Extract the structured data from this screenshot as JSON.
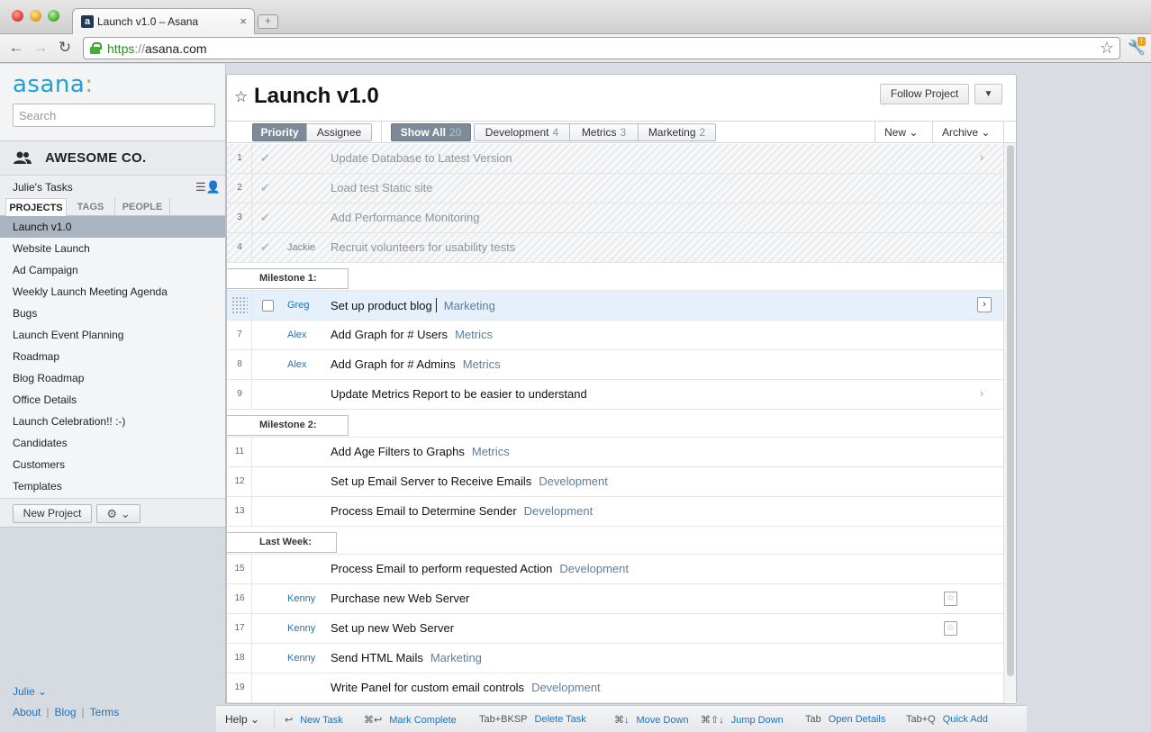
{
  "browser": {
    "tab_title": "Launch v1.0 – Asana",
    "tab_favicon": "a",
    "url_scheme": "https",
    "url_sep": "://",
    "url_host": "asana.com",
    "new_tab_glyph": "+",
    "close_glyph": "×"
  },
  "sidebar": {
    "logo": "asana",
    "logo_dots": ":",
    "search_placeholder": "Search",
    "workspace": "AWESOME CO.",
    "my_tasks": "Julie's Tasks",
    "tabs": [
      "PROJECTS",
      "TAGS",
      "PEOPLE"
    ],
    "projects": [
      "Launch v1.0",
      "Website Launch",
      "Ad Campaign",
      "Weekly Launch Meeting Agenda",
      "Bugs",
      "Launch Event Planning",
      "Roadmap",
      "Blog Roadmap",
      "Office Details",
      "Launch Celebration!! :-)",
      "Candidates",
      "Customers",
      "Templates"
    ],
    "active_project_index": 0,
    "new_project_label": "New Project",
    "user": "Julie",
    "footer_links": [
      "About",
      "Blog",
      "Terms"
    ]
  },
  "main": {
    "title": "Launch  v1.0",
    "follow_label": "Follow Project",
    "filters": {
      "priority": "Priority",
      "assignee": "Assignee",
      "show_all": "Show All",
      "show_all_count": "20",
      "development": "Development",
      "development_count": "4",
      "metrics": "Metrics",
      "metrics_count": "3",
      "marketing": "Marketing",
      "marketing_count": "2",
      "new": "New",
      "archive": "Archive"
    },
    "rows": [
      {
        "type": "task",
        "num": "1",
        "done": true,
        "assignee": "",
        "name": "Update Database to Latest Version",
        "tag": "",
        "arrow": true
      },
      {
        "type": "task",
        "num": "2",
        "done": true,
        "assignee": "",
        "name": "Load test Static site",
        "tag": ""
      },
      {
        "type": "task",
        "num": "3",
        "done": true,
        "assignee": "",
        "name": "Add Performance Monitoring",
        "tag": ""
      },
      {
        "type": "task",
        "num": "4",
        "done": true,
        "assignee": "Jackie",
        "name": "Recruit volunteers for usability tests",
        "tag": ""
      },
      {
        "type": "section",
        "label": "Milestone 1:"
      },
      {
        "type": "task",
        "num": "",
        "selected": true,
        "assignee": "Greg",
        "name": "Set up product blog",
        "tag": "Marketing",
        "arrow_box": true
      },
      {
        "type": "task",
        "num": "7",
        "assignee": "Alex",
        "name": "Add Graph for # Users",
        "tag": "Metrics"
      },
      {
        "type": "task",
        "num": "8",
        "assignee": "Alex",
        "name": "Add Graph for # Admins",
        "tag": "Metrics"
      },
      {
        "type": "task",
        "num": "9",
        "assignee": "",
        "name": "Update Metrics Report to be easier to understand",
        "tag": "",
        "arrow": true
      },
      {
        "type": "section",
        "label": "Milestone 2:"
      },
      {
        "type": "task",
        "num": "11",
        "assignee": "",
        "name": "Add Age Filters to Graphs",
        "tag": "Metrics"
      },
      {
        "type": "task",
        "num": "12",
        "assignee": "",
        "name": "Set up Email Server to Receive Emails",
        "tag": "Development"
      },
      {
        "type": "task",
        "num": "13",
        "assignee": "",
        "name": "Process Email to Determine Sender",
        "tag": "Development"
      },
      {
        "type": "section",
        "label": "Last Week:"
      },
      {
        "type": "task",
        "num": "15",
        "assignee": "",
        "name": "Process Email to perform requested Action",
        "tag": "Development"
      },
      {
        "type": "task",
        "num": "16",
        "assignee": "Kenny",
        "name": "Purchase new Web Server",
        "tag": "",
        "calendar": true
      },
      {
        "type": "task",
        "num": "17",
        "assignee": "Kenny",
        "name": "Set up new Web Server",
        "tag": "",
        "calendar": true
      },
      {
        "type": "task",
        "num": "18",
        "assignee": "Kenny",
        "name": "Send HTML Mails",
        "tag": "Marketing"
      },
      {
        "type": "task",
        "num": "19",
        "assignee": "",
        "name": "Write Panel for custom email controls",
        "tag": "Development"
      }
    ]
  },
  "shortcuts": {
    "help": "Help",
    "items": [
      {
        "key": "↩",
        "action": "New Task"
      },
      {
        "key": "⌘↩",
        "action": "Mark Complete"
      },
      {
        "key": "Tab+BKSP",
        "action": "Delete Task"
      },
      {
        "key": "⌘↓",
        "action": "Move Down"
      },
      {
        "key": "⌘⇧↓",
        "action": "Jump Down"
      },
      {
        "key": "Tab",
        "action": "Open Details"
      },
      {
        "key": "Tab+Q",
        "action": "Quick Add"
      }
    ]
  },
  "colors": {
    "brand": "#1aa3d4",
    "link": "#1f72b8",
    "tag": "#5d7e9d",
    "active_filter": "#7d8a98"
  }
}
